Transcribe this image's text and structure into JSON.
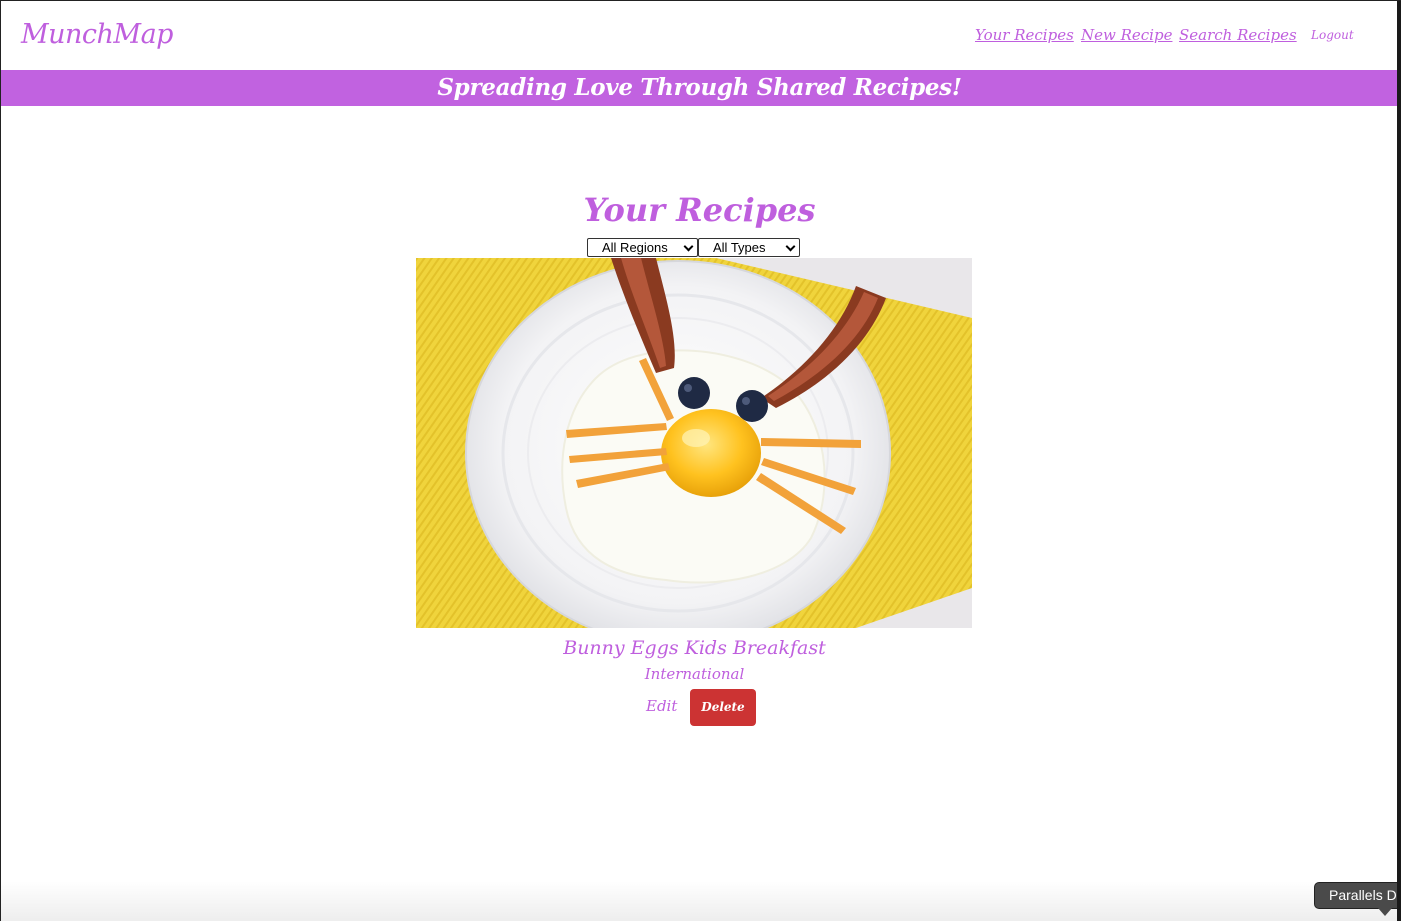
{
  "navbar": {
    "brand": "MunchMap",
    "links": {
      "your_recipes": "Your Recipes",
      "new_recipe": "New Recipe",
      "search_recipes": "Search Recipes",
      "logout": "Logout"
    }
  },
  "banner": {
    "text": "Spreading Love Through Shared Recipes!"
  },
  "main": {
    "heading": "Your Recipes",
    "filters": {
      "region": {
        "selected": "All Regions"
      },
      "type": {
        "selected": "All Types"
      }
    },
    "recipes": [
      {
        "title": "Bunny Eggs Kids Breakfast",
        "region": "International",
        "edit_label": "Edit",
        "delete_label": "Delete"
      }
    ]
  },
  "os": {
    "tooltip": "Parallels Desktop"
  },
  "colors": {
    "accent": "#bf5fde",
    "banner": "#c162e0",
    "delete": "#cc3333"
  }
}
